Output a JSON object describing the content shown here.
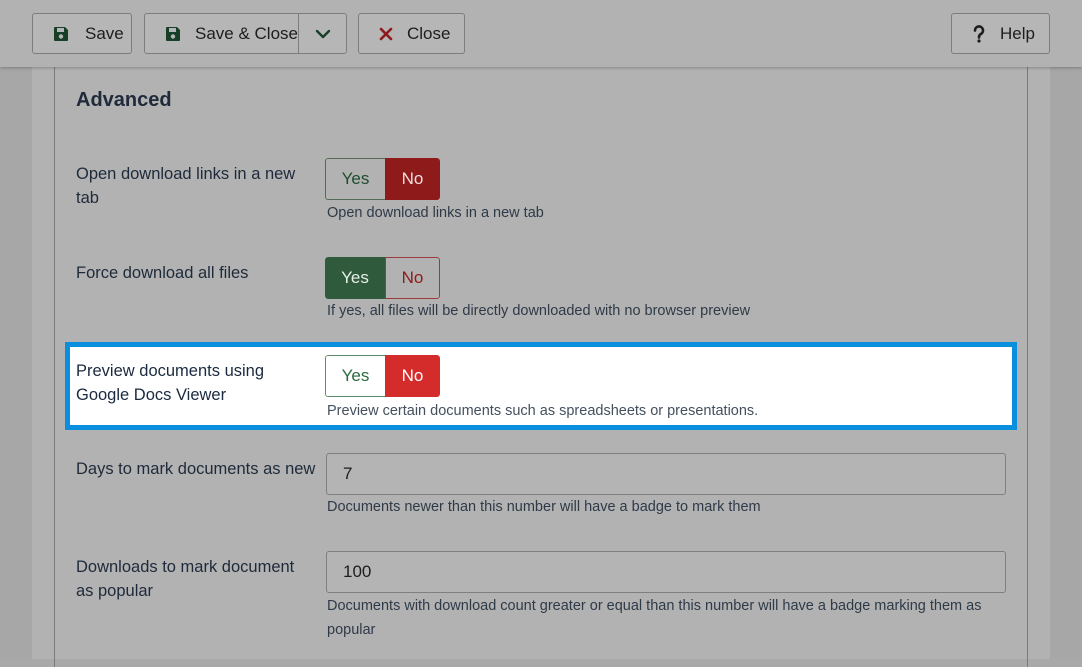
{
  "toolbar": {
    "save_label": "Save",
    "save_close_label": "Save & Close",
    "close_label": "Close",
    "help_label": "Help"
  },
  "section": {
    "title": "Advanced"
  },
  "fields": [
    {
      "label": "Open download links in a new tab",
      "type": "toggle",
      "value": "No",
      "yes": "Yes",
      "no": "No",
      "description": "Open download links in a new tab"
    },
    {
      "label": "Force download all files",
      "type": "toggle",
      "value": "Yes",
      "yes": "Yes",
      "no": "No",
      "description": "If yes, all files will be directly downloaded with no browser preview"
    },
    {
      "label": "Preview documents using Google Docs Viewer",
      "type": "toggle",
      "value": "No",
      "yes": "Yes",
      "no": "No",
      "description": "Preview certain documents such as spreadsheets or presentations."
    },
    {
      "label": "Days to mark documents as new",
      "type": "text",
      "value": "7",
      "description": "Documents newer than this number will have a badge to mark them"
    },
    {
      "label": "Downloads to mark document as popular",
      "type": "text",
      "value": "100",
      "description": "Documents with download count greater or equal than this number will have a badge marking them as popular"
    }
  ],
  "colors": {
    "highlight_border": "#0a8ede",
    "yes_active": "#2f5a3b",
    "no_active": "#d42b2b"
  },
  "icons": {
    "save": "floppy-disk-icon",
    "chevron": "chevron-down-icon",
    "close": "x-icon",
    "help": "question-mark-icon"
  }
}
